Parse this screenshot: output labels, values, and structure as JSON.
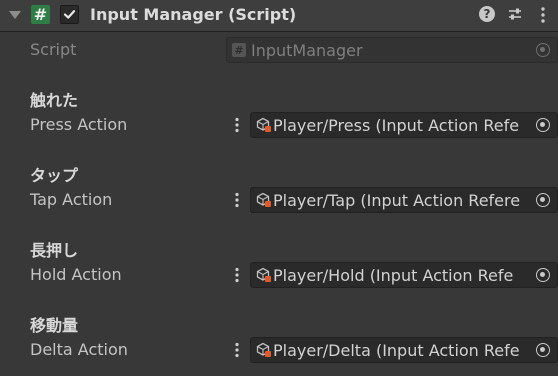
{
  "header": {
    "title": "Input Manager (Script)",
    "script_icon_glyph": "#",
    "enabled": true,
    "help_glyph": "?",
    "icons": [
      "foldout-arrow-icon",
      "script-icon",
      "checkbox-icon",
      "help-icon",
      "settings-icon",
      "kebab-menu-icon"
    ]
  },
  "script_row": {
    "label": "Script",
    "value": "InputManager",
    "icon_glyph": "#"
  },
  "groups": [
    {
      "heading": "触れた",
      "label": "Press Action",
      "value": "Player/Press (Input Action Refe"
    },
    {
      "heading": "タップ",
      "label": "Tap Action",
      "value": "Player/Tap (Input Action Refere"
    },
    {
      "heading": "長押し",
      "label": "Hold Action",
      "value": "Player/Hold (Input Action Refe"
    },
    {
      "heading": "移動量",
      "label": "Delta Action",
      "value": "Player/Delta (Input Action Refe"
    }
  ],
  "colors": {
    "background": "#383838",
    "header": "#3e3e3e",
    "script_badge": "#2e7d46",
    "field": "#2a2a2a",
    "asset_icon_accent": "#e05a2a"
  }
}
